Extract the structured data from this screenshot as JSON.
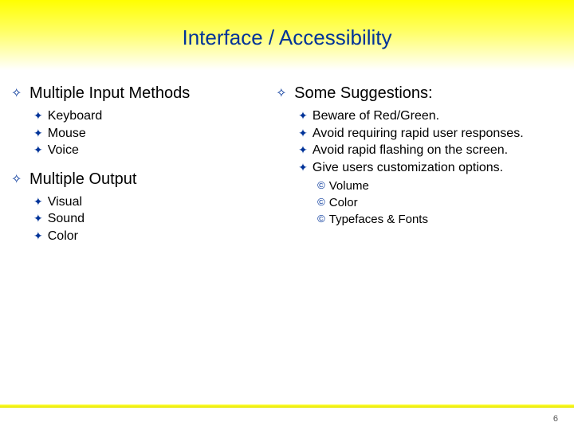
{
  "title": "Interface / Accessibility",
  "bullets": {
    "diamond": "✧",
    "star": "✦",
    "copy": "©"
  },
  "left": {
    "sections": [
      {
        "heading": "Multiple Input Methods",
        "items": [
          "Keyboard",
          "Mouse",
          "Voice"
        ]
      },
      {
        "heading": "Multiple Output",
        "items": [
          "Visual",
          "Sound",
          "Color"
        ]
      }
    ]
  },
  "right": {
    "heading": "Some Suggestions:",
    "items": [
      {
        "text": "Beware of Red/Green."
      },
      {
        "text": "Avoid requiring rapid user responses."
      },
      {
        "text": "Avoid rapid flashing on the screen."
      },
      {
        "text": "Give users customization options.",
        "sub": [
          "Volume",
          "Color",
          "Typefaces & Fonts"
        ]
      }
    ]
  },
  "pageNumber": "6"
}
